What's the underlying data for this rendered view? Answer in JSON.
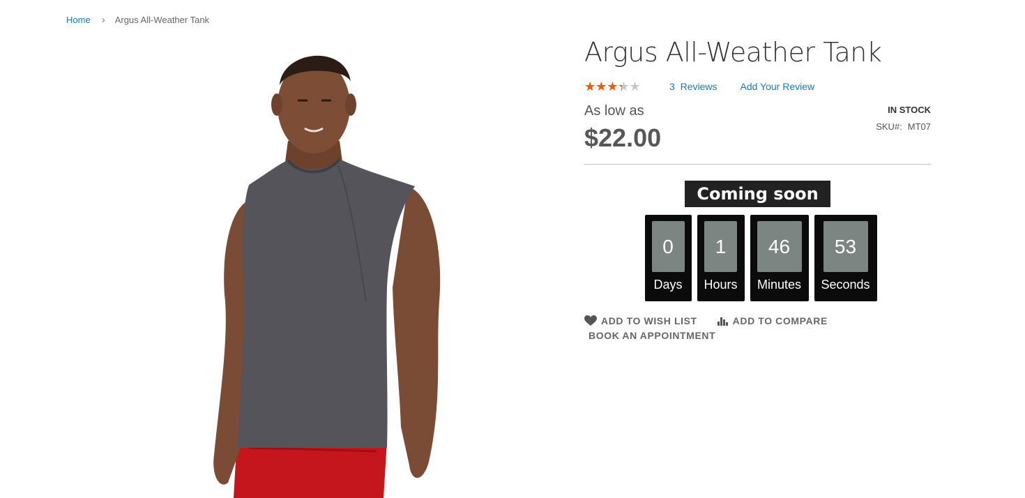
{
  "breadcrumb": {
    "home": "Home",
    "separator": "›",
    "current": "Argus All-Weather Tank"
  },
  "product": {
    "title": "Argus All-Weather Tank",
    "rating_fraction": 0.6,
    "stars": "★★★★★",
    "reviews_count": "3",
    "reviews_label": "Reviews",
    "add_review": "Add Your Review",
    "price_prefix": "As low as",
    "price": "$22.00",
    "stock": "In stock",
    "sku_label": "SKU#:",
    "sku": "MT07",
    "image_icon": "product-photo-model-tank"
  },
  "countdown": {
    "title": "Coming soon",
    "units": [
      {
        "value": "0",
        "label": "Days"
      },
      {
        "value": "1",
        "label": "Hours"
      },
      {
        "value": "46",
        "label": "Minutes"
      },
      {
        "value": "53",
        "label": "Seconds"
      }
    ]
  },
  "actions": {
    "wishlist": "Add to Wish List",
    "compare": "Add to Compare",
    "appointment": "Book an Appointment",
    "appointment_glyph": ""
  },
  "colors": {
    "link": "#1979c3",
    "star": "#ff5501",
    "countdown_box": "#0b0b0b",
    "countdown_num": "#7d8583"
  }
}
